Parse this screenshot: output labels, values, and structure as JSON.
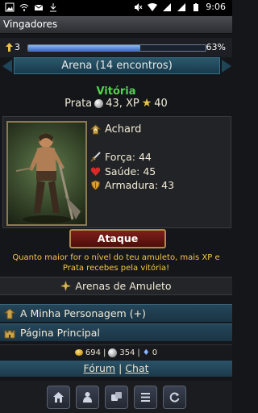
{
  "status_bar": {
    "time": "9:06"
  },
  "app": {
    "title": "Vingadores"
  },
  "xp": {
    "level": "3",
    "percent_label": "63%",
    "progress": 0.63
  },
  "arena": {
    "title": "Arena (14 encontros)"
  },
  "battle": {
    "result": "Vitória",
    "rewards_prefix": "Prata",
    "silver": "43, XP",
    "xp": "40"
  },
  "opponent": {
    "name": "Achard",
    "forca": "Força: 44",
    "saude": "Saúde: 45",
    "armadura": "Armadura: 43"
  },
  "attack_button": "Ataque",
  "hint": "Quanto maior for o nível do teu amuleto, mais XP e Prata recebes pela vitória!",
  "amulet_section": "Arenas de Amuleto",
  "nav": {
    "character": "A Minha Personagem (+)",
    "home": "Página Principal"
  },
  "currency": {
    "gold": "694",
    "silver": "354",
    "gems": "0"
  },
  "links": {
    "forum": "Fórum",
    "separator": "|",
    "chat": "Chat"
  },
  "colors": {
    "victory": "#4cd64c",
    "hint": "#f4c64a",
    "attack_bg": "#7e1f1a",
    "nav_bg": "#25465a"
  },
  "icons": [
    "home-icon",
    "character-icon",
    "items-icon",
    "list-icon",
    "refresh-icon"
  ]
}
